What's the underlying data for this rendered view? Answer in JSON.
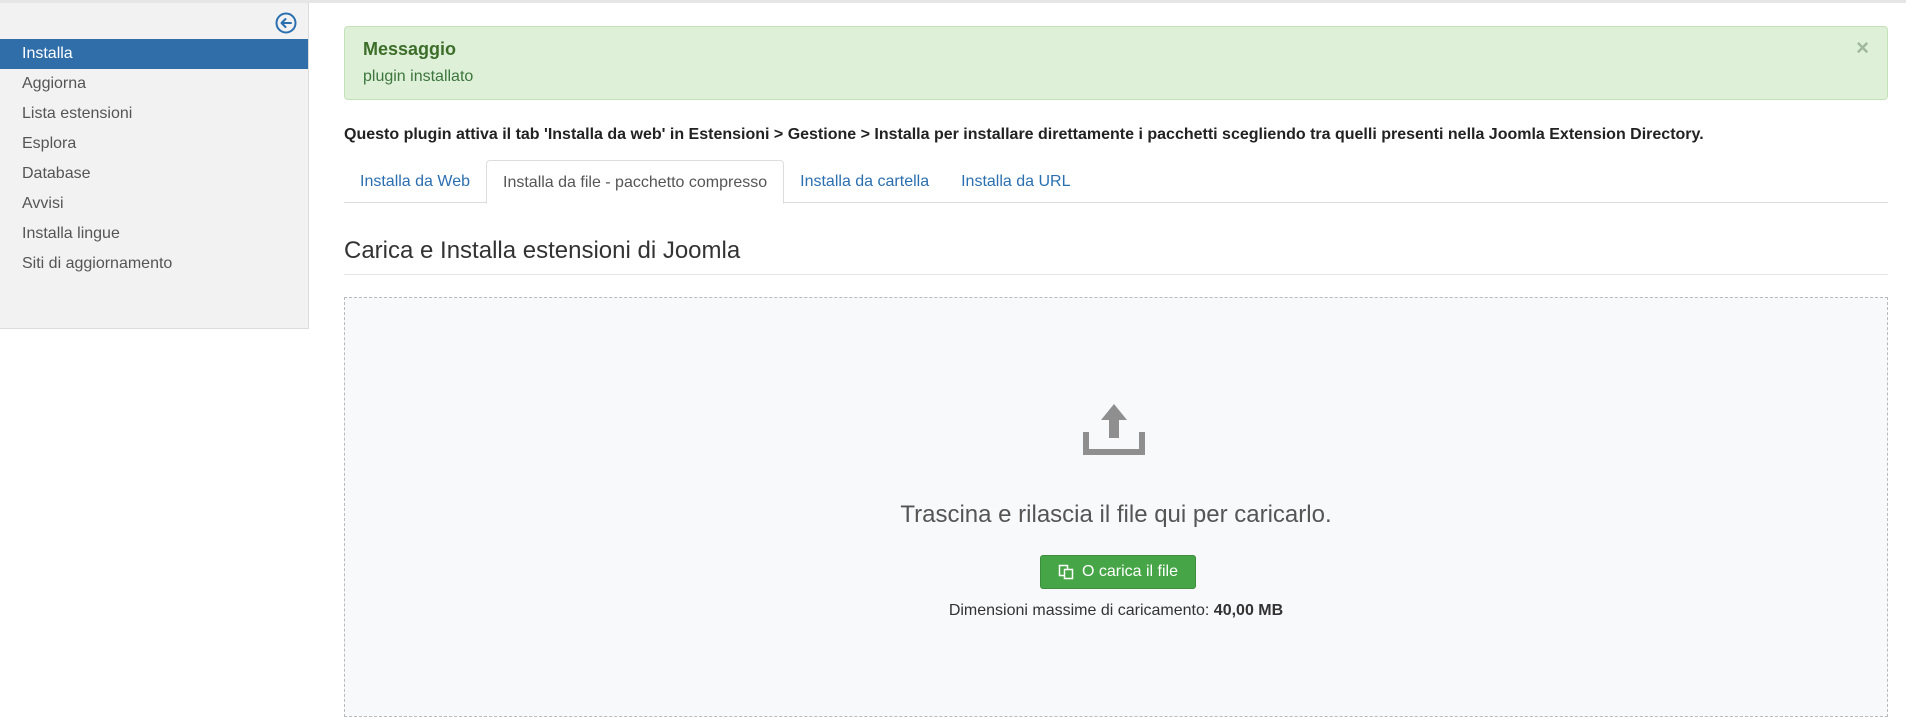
{
  "sidebar": {
    "toggle_icon": "arrow-circle-left-icon",
    "items": [
      {
        "label": "Installa",
        "active": true
      },
      {
        "label": "Aggiorna",
        "active": false
      },
      {
        "label": "Lista estensioni",
        "active": false
      },
      {
        "label": "Esplora",
        "active": false
      },
      {
        "label": "Database",
        "active": false
      },
      {
        "label": "Avvisi",
        "active": false
      },
      {
        "label": "Installa lingue",
        "active": false
      },
      {
        "label": "Siti di aggiornamento",
        "active": false
      }
    ]
  },
  "alert": {
    "heading": "Messaggio",
    "text": "plugin installato",
    "close_label": "×"
  },
  "info_text": "Questo plugin attiva il tab 'Installa da web' in Estensioni > Gestione > Installa per installare direttamente i pacchetti scegliendo tra quelli presenti nella Joomla Extension Directory.",
  "tabs": [
    {
      "label": "Installa da Web",
      "active": false
    },
    {
      "label": "Installa da file - pacchetto compresso",
      "active": true
    },
    {
      "label": "Installa da cartella",
      "active": false
    },
    {
      "label": "Installa da URL",
      "active": false
    }
  ],
  "section_title": "Carica e Installa estensioni di Joomla",
  "dropzone": {
    "icon": "upload-icon",
    "text": "Trascina e rilascia il file qui per caricarlo.",
    "button_label": "O carica il file",
    "button_icon": "copy-icon",
    "max_size_label": "Dimensioni massime di caricamento:",
    "max_size_value": "40,00 MB"
  },
  "colors": {
    "sidebar_active": "#2f6ea9",
    "alert_bg": "#dff0d8",
    "link": "#2a6fb0",
    "button_green": "#46a546"
  }
}
